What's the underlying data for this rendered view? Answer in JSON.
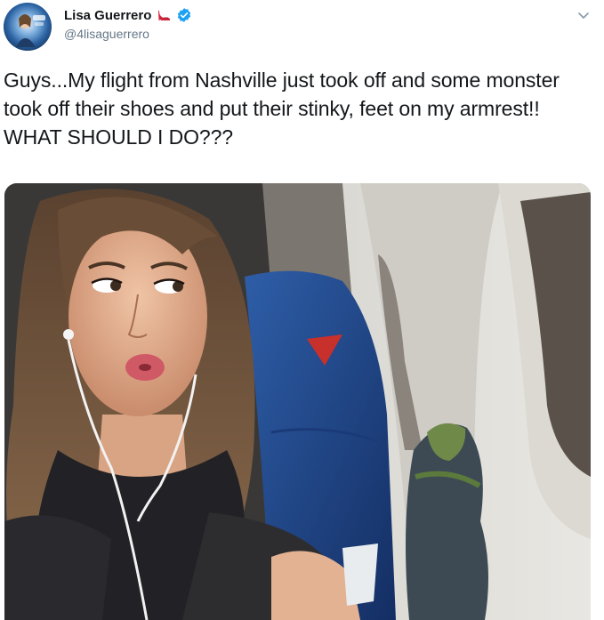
{
  "tweet": {
    "author": {
      "display_name": "Lisa Guerrero",
      "handle": "@4lisaguerrero",
      "verified": true,
      "name_emoji": "high-heel-shoe-icon"
    },
    "text": "Guys...My flight from Nashville just took off and some monster took off their shoes and put their stinky, feet on my armrest!! WHAT SHOULD I DO???",
    "more_menu_icon": "chevron-down-icon",
    "media": {
      "type": "photo",
      "subject": "selfie-in-airplane-seat-with-feet-on-armrest"
    }
  },
  "colors": {
    "text_primary": "#14171a",
    "text_secondary": "#657786",
    "verified_blue": "#1da1f2"
  }
}
